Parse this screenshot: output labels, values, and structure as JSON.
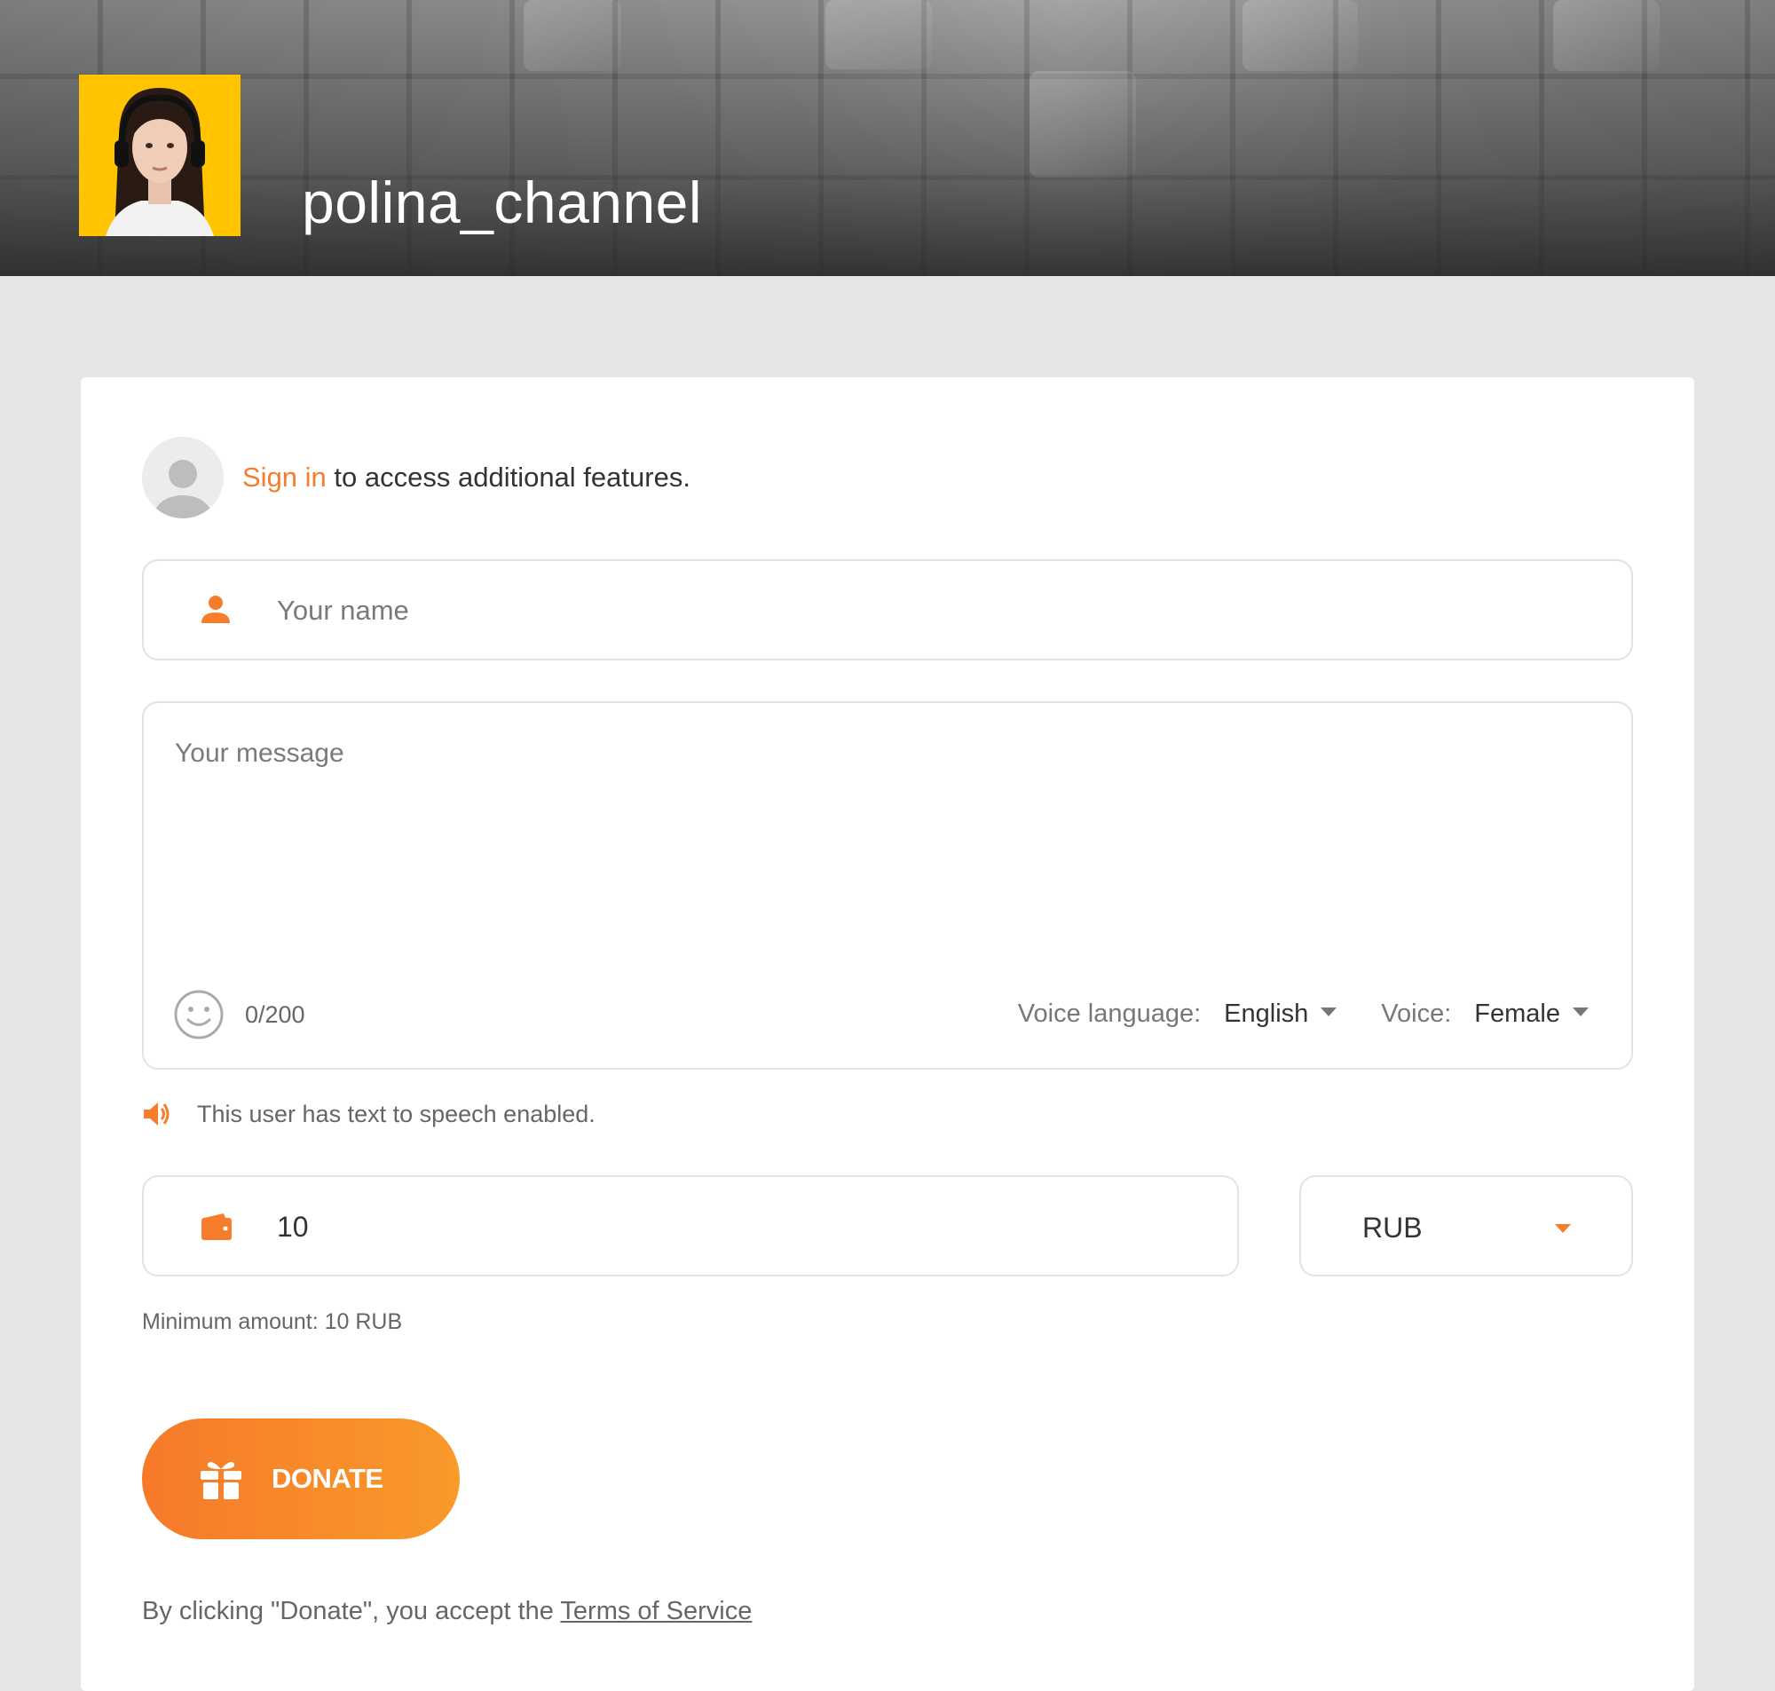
{
  "header": {
    "channel_name": "polina_channel"
  },
  "signin": {
    "link_text": "Sign in",
    "rest_text": " to access additional features."
  },
  "form": {
    "name_placeholder": "Your name",
    "message_placeholder": "Your message",
    "char_counter": "0/200",
    "voice_language_label": "Voice language:",
    "voice_language_value": "English",
    "voice_label": "Voice:",
    "voice_value": "Female",
    "tts_note": "This user has text to speech enabled.",
    "amount_value": "10",
    "currency_value": "RUB",
    "min_amount": "Minimum amount: 10 RUB",
    "donate_label": "DONATE",
    "tos_prefix": "By clicking \"Donate\", you accept the ",
    "tos_link": "Terms of Service"
  },
  "colors": {
    "accent": "#f57d2b",
    "avatar_bg": "#ffc300",
    "page_bg": "#e6e6e6"
  },
  "icons": {
    "user": "user-icon",
    "emoji": "smiley-icon",
    "speaker": "speaker-icon",
    "wallet": "wallet-icon",
    "gift": "gift-icon",
    "caret": "chevron-down-icon"
  }
}
